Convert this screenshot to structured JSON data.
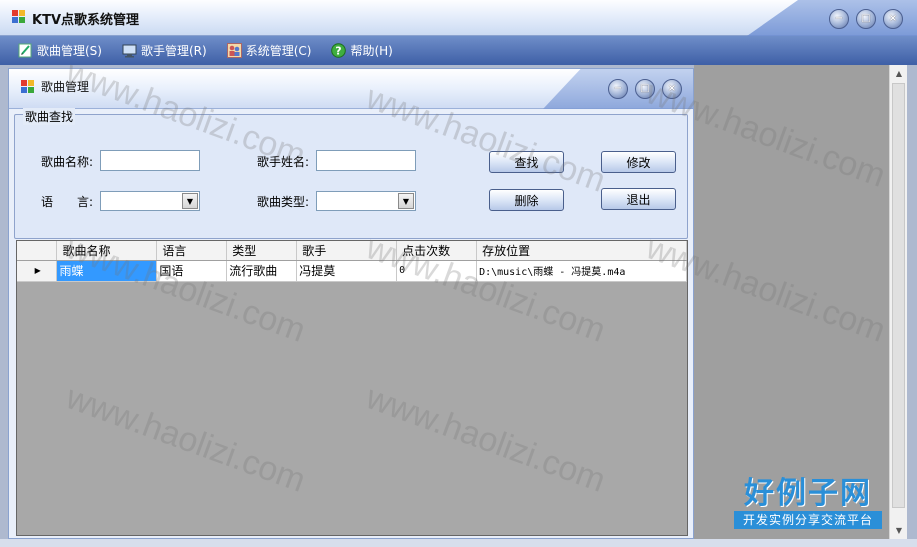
{
  "window": {
    "title": "KTV点歌系统管理"
  },
  "menu": [
    {
      "label": "歌曲管理(S)",
      "icon": "music-edit-icon"
    },
    {
      "label": "歌手管理(R)",
      "icon": "singer-monitor-icon"
    },
    {
      "label": "系统管理(C)",
      "icon": "system-users-icon"
    },
    {
      "label": "帮助(H)",
      "icon": "help-icon"
    }
  ],
  "child": {
    "title": "歌曲管理",
    "group_title": "歌曲查找",
    "song_name_label": "歌曲名称:",
    "song_name_value": "",
    "singer_label": "歌手姓名:",
    "singer_value": "",
    "language_label_1": "语",
    "language_label_2": "言:",
    "language_value": "",
    "type_label": "歌曲类型:",
    "type_value": "",
    "buttons": {
      "search": "查找",
      "edit": "修改",
      "delete": "删除",
      "exit": "退出"
    }
  },
  "grid": {
    "columns": [
      "歌曲名称",
      "语言",
      "类型",
      "歌手",
      "点击次数",
      "存放位置"
    ],
    "rows": [
      [
        "雨蝶",
        "国语",
        "流行歌曲",
        "冯提莫",
        "0",
        "D:\\music\\雨蝶 - 冯提莫.m4a"
      ]
    ]
  },
  "watermark": {
    "text": "www.haolizi.com",
    "logo_main": "好例子网",
    "logo_sub": "开发实例分享交流平台"
  },
  "colors": {
    "menubar": "#3e5fa6",
    "selection": "#3399ff",
    "logo": "#2a8fd8"
  }
}
